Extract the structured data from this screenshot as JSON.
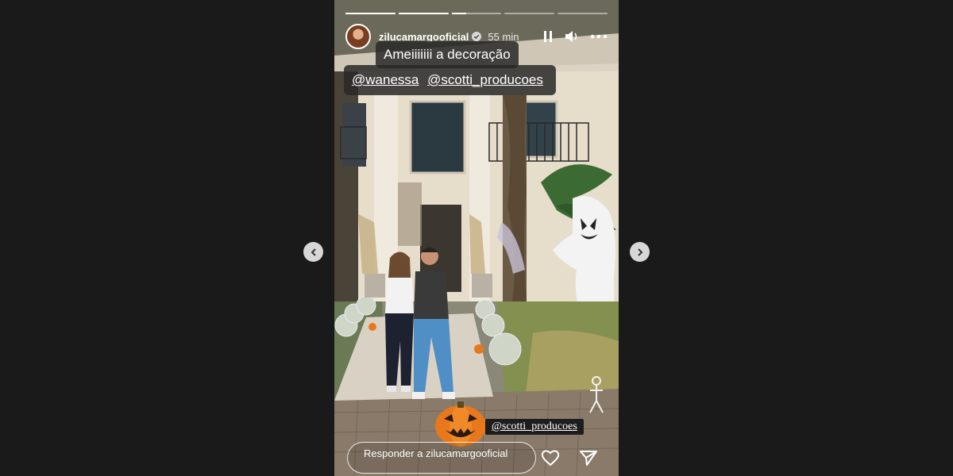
{
  "story": {
    "username": "zilucamargooficial",
    "timestamp": "55 min",
    "progress": [
      1,
      1,
      0.3,
      0,
      0
    ],
    "caption": "Ameiiiiiii a decoração",
    "mentions": [
      "@wanessa",
      "@scotti_producoes"
    ],
    "mention_sticker": "@scotti_producoes",
    "reply_placeholder": "Responder a zilucamargooficial"
  },
  "icons": {
    "verified": "verified-badge-icon",
    "pause": "pause-icon",
    "volume": "volume-icon",
    "more": "more-options-icon",
    "like": "heart-icon",
    "share": "send-icon",
    "prev": "chevron-left-icon",
    "next": "chevron-right-icon"
  },
  "colors": {
    "page_bg": "#1a1a1a",
    "verified_blue": "#3897f0",
    "pumpkin": "#e8781c"
  }
}
